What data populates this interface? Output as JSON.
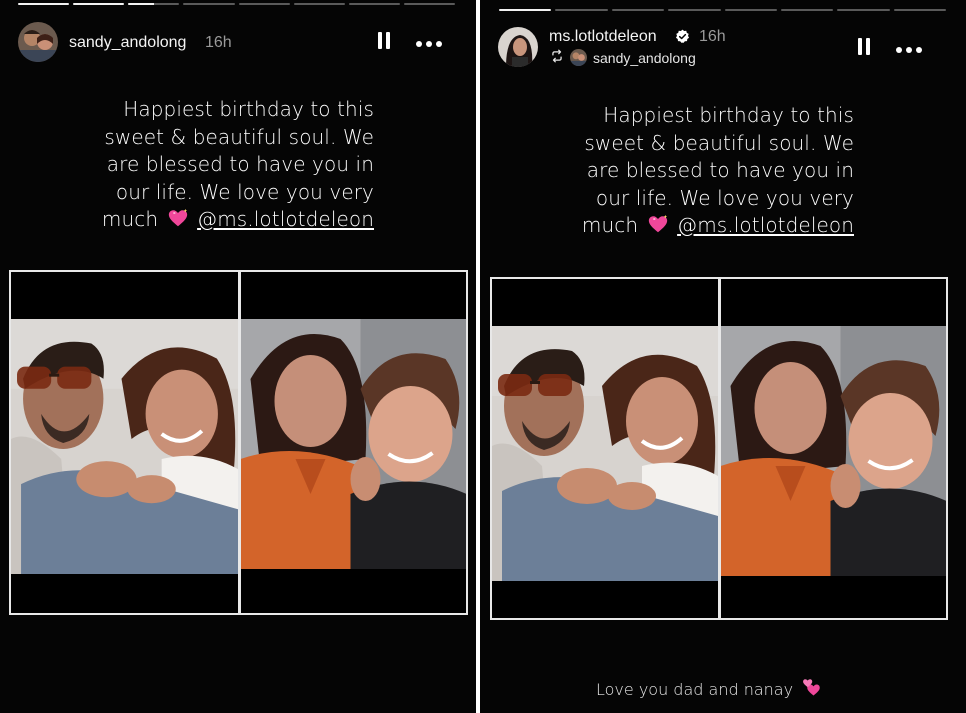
{
  "stories": [
    {
      "username": "sandy_andolong",
      "time": "16h",
      "verified": false,
      "progress": [
        1,
        1,
        0.5,
        0,
        0,
        0,
        0,
        0
      ],
      "caption_lines": [
        "Happiest birthday to this",
        "sweet & beautiful soul. We",
        "are blessed to have you in",
        "our life. We love you very"
      ],
      "caption_last": "much",
      "caption_emoji": "sparkling-heart",
      "mention": "@ms.lotlotdeleon",
      "icons": {
        "pause": "pause-icon",
        "more": "more-icon"
      }
    },
    {
      "username": "ms.lotlotdeleon",
      "time": "16h",
      "verified": true,
      "repost_from": "sandy_andolong",
      "progress": [
        1,
        0,
        0,
        0,
        0,
        0,
        0,
        0
      ],
      "caption_lines": [
        "Happiest birthday to this",
        "sweet & beautiful soul. We",
        "are blessed to have you in",
        "our life. We love you very"
      ],
      "caption_last": "much",
      "caption_emoji": "sparkling-heart",
      "mention": "@ms.lotlotdeleon",
      "footer_text": "Love you dad and nanay",
      "footer_emoji": "two-hearts",
      "icons": {
        "pause": "pause-icon",
        "more": "more-icon",
        "repost": "repost-icon"
      }
    }
  ],
  "colors": {
    "background": "#050505",
    "text": "#ffffff",
    "muted": "#9a9a9a",
    "accent_heart": "#f0479a"
  }
}
